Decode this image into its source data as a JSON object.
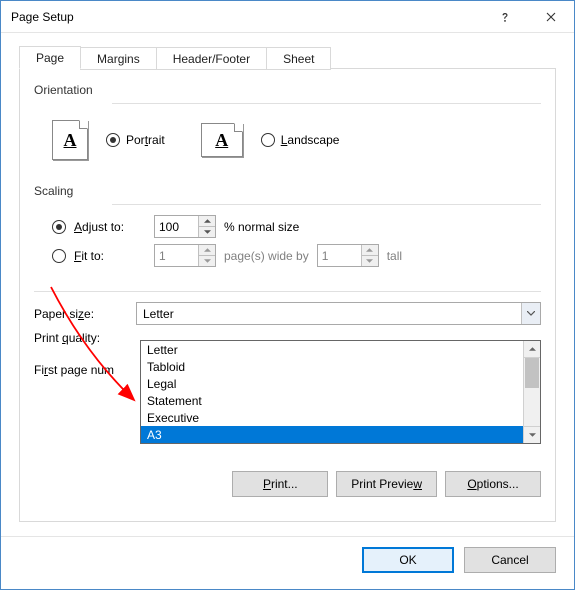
{
  "window": {
    "title": "Page Setup"
  },
  "tabs": {
    "page": "Page",
    "margins": "Margins",
    "headerfooter": "Header/Footer",
    "sheet": "Sheet"
  },
  "orientation": {
    "label": "Orientation",
    "portrait": "Portrait",
    "landscape": "Landscape",
    "glyph": "A",
    "selected": "portrait"
  },
  "scaling": {
    "label": "Scaling",
    "adjust_to": "Adjust to:",
    "adjust_value": "100",
    "adjust_suffix": "% normal size",
    "fit_to": "Fit to:",
    "fit_wide": "1",
    "fit_mid": "page(s) wide by",
    "fit_tall_val": "1",
    "fit_tall": "tall",
    "selected": "adjust"
  },
  "paper": {
    "size_label": "Paper size:",
    "size_value": "Letter",
    "options": [
      "Letter",
      "Tabloid",
      "Legal",
      "Statement",
      "Executive",
      "A3"
    ],
    "highlighted": "A3",
    "quality_label": "Print quality:"
  },
  "firstpage": {
    "label": "First page num"
  },
  "buttons": {
    "print": "Print...",
    "preview": "Print Preview",
    "options": "Options...",
    "ok": "OK",
    "cancel": "Cancel"
  }
}
